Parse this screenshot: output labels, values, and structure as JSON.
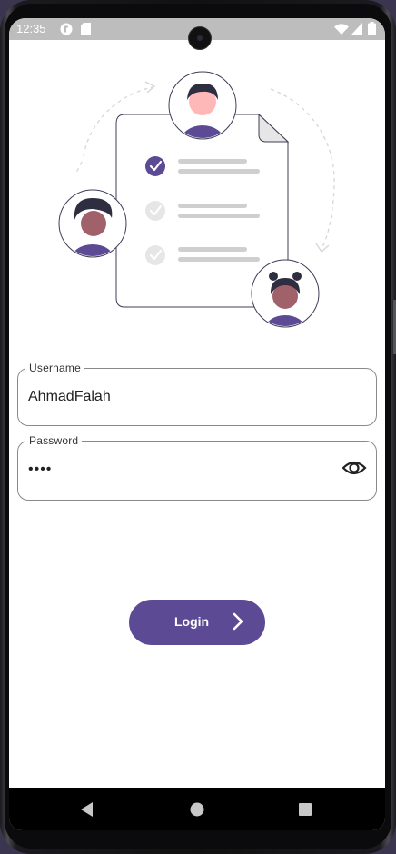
{
  "status_bar": {
    "time": "12:35",
    "icons": [
      "notification-app-icon",
      "sd-card-icon",
      "wifi-icon",
      "signal-icon",
      "battery-icon"
    ]
  },
  "illustration": {
    "name": "checklist-team-illustration",
    "accent_color": "#5d4a94"
  },
  "form": {
    "username": {
      "label": "Username",
      "value": "AhmadFalah"
    },
    "password": {
      "label": "Password",
      "value": "••••",
      "toggle_icon": "eye-icon"
    },
    "login_button": {
      "label": "Login",
      "icon": "chevron-right-icon"
    }
  },
  "nav_bar": {
    "buttons": [
      "back-icon",
      "home-icon",
      "recents-icon"
    ]
  },
  "colors": {
    "primary": "#5d4a94",
    "status_bar": "#bdbdbd",
    "field_border": "#8a8a8a"
  }
}
